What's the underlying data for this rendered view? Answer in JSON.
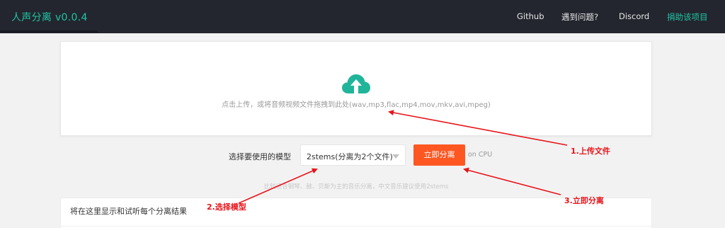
{
  "header": {
    "logo": "人声分离 v0.0.4",
    "nav": [
      {
        "label": "Github"
      },
      {
        "label": "遇到问题?"
      },
      {
        "label": "Discord"
      },
      {
        "label": "捐助该项目"
      }
    ]
  },
  "upload": {
    "icon": "cloud-upload-icon",
    "hint": "点击上传，或将音频视频文件拖拽到此处(wav,mp3,flac,mp4,mov,mkv,avi,mpeg)"
  },
  "model": {
    "label": "选择要使用的模型",
    "selected": "2stems(分离为2个文件)",
    "button": "立即分离",
    "cpu_note": "on CPU",
    "tip": "比较适合钢琴、鼓、贝斯为主的音乐分离，中文音乐建议使用2stems"
  },
  "results": {
    "title": "将在这里显示和试听每个分离结果"
  },
  "annotations": [
    {
      "label": "1.上传文件"
    },
    {
      "label": "2.选择模型"
    },
    {
      "label": "3.立即分离"
    }
  ],
  "colors": {
    "header_bg": "#23262e",
    "accent": "#20c5a6",
    "primary_button": "#ff5722",
    "annotation": "#e8141a"
  }
}
